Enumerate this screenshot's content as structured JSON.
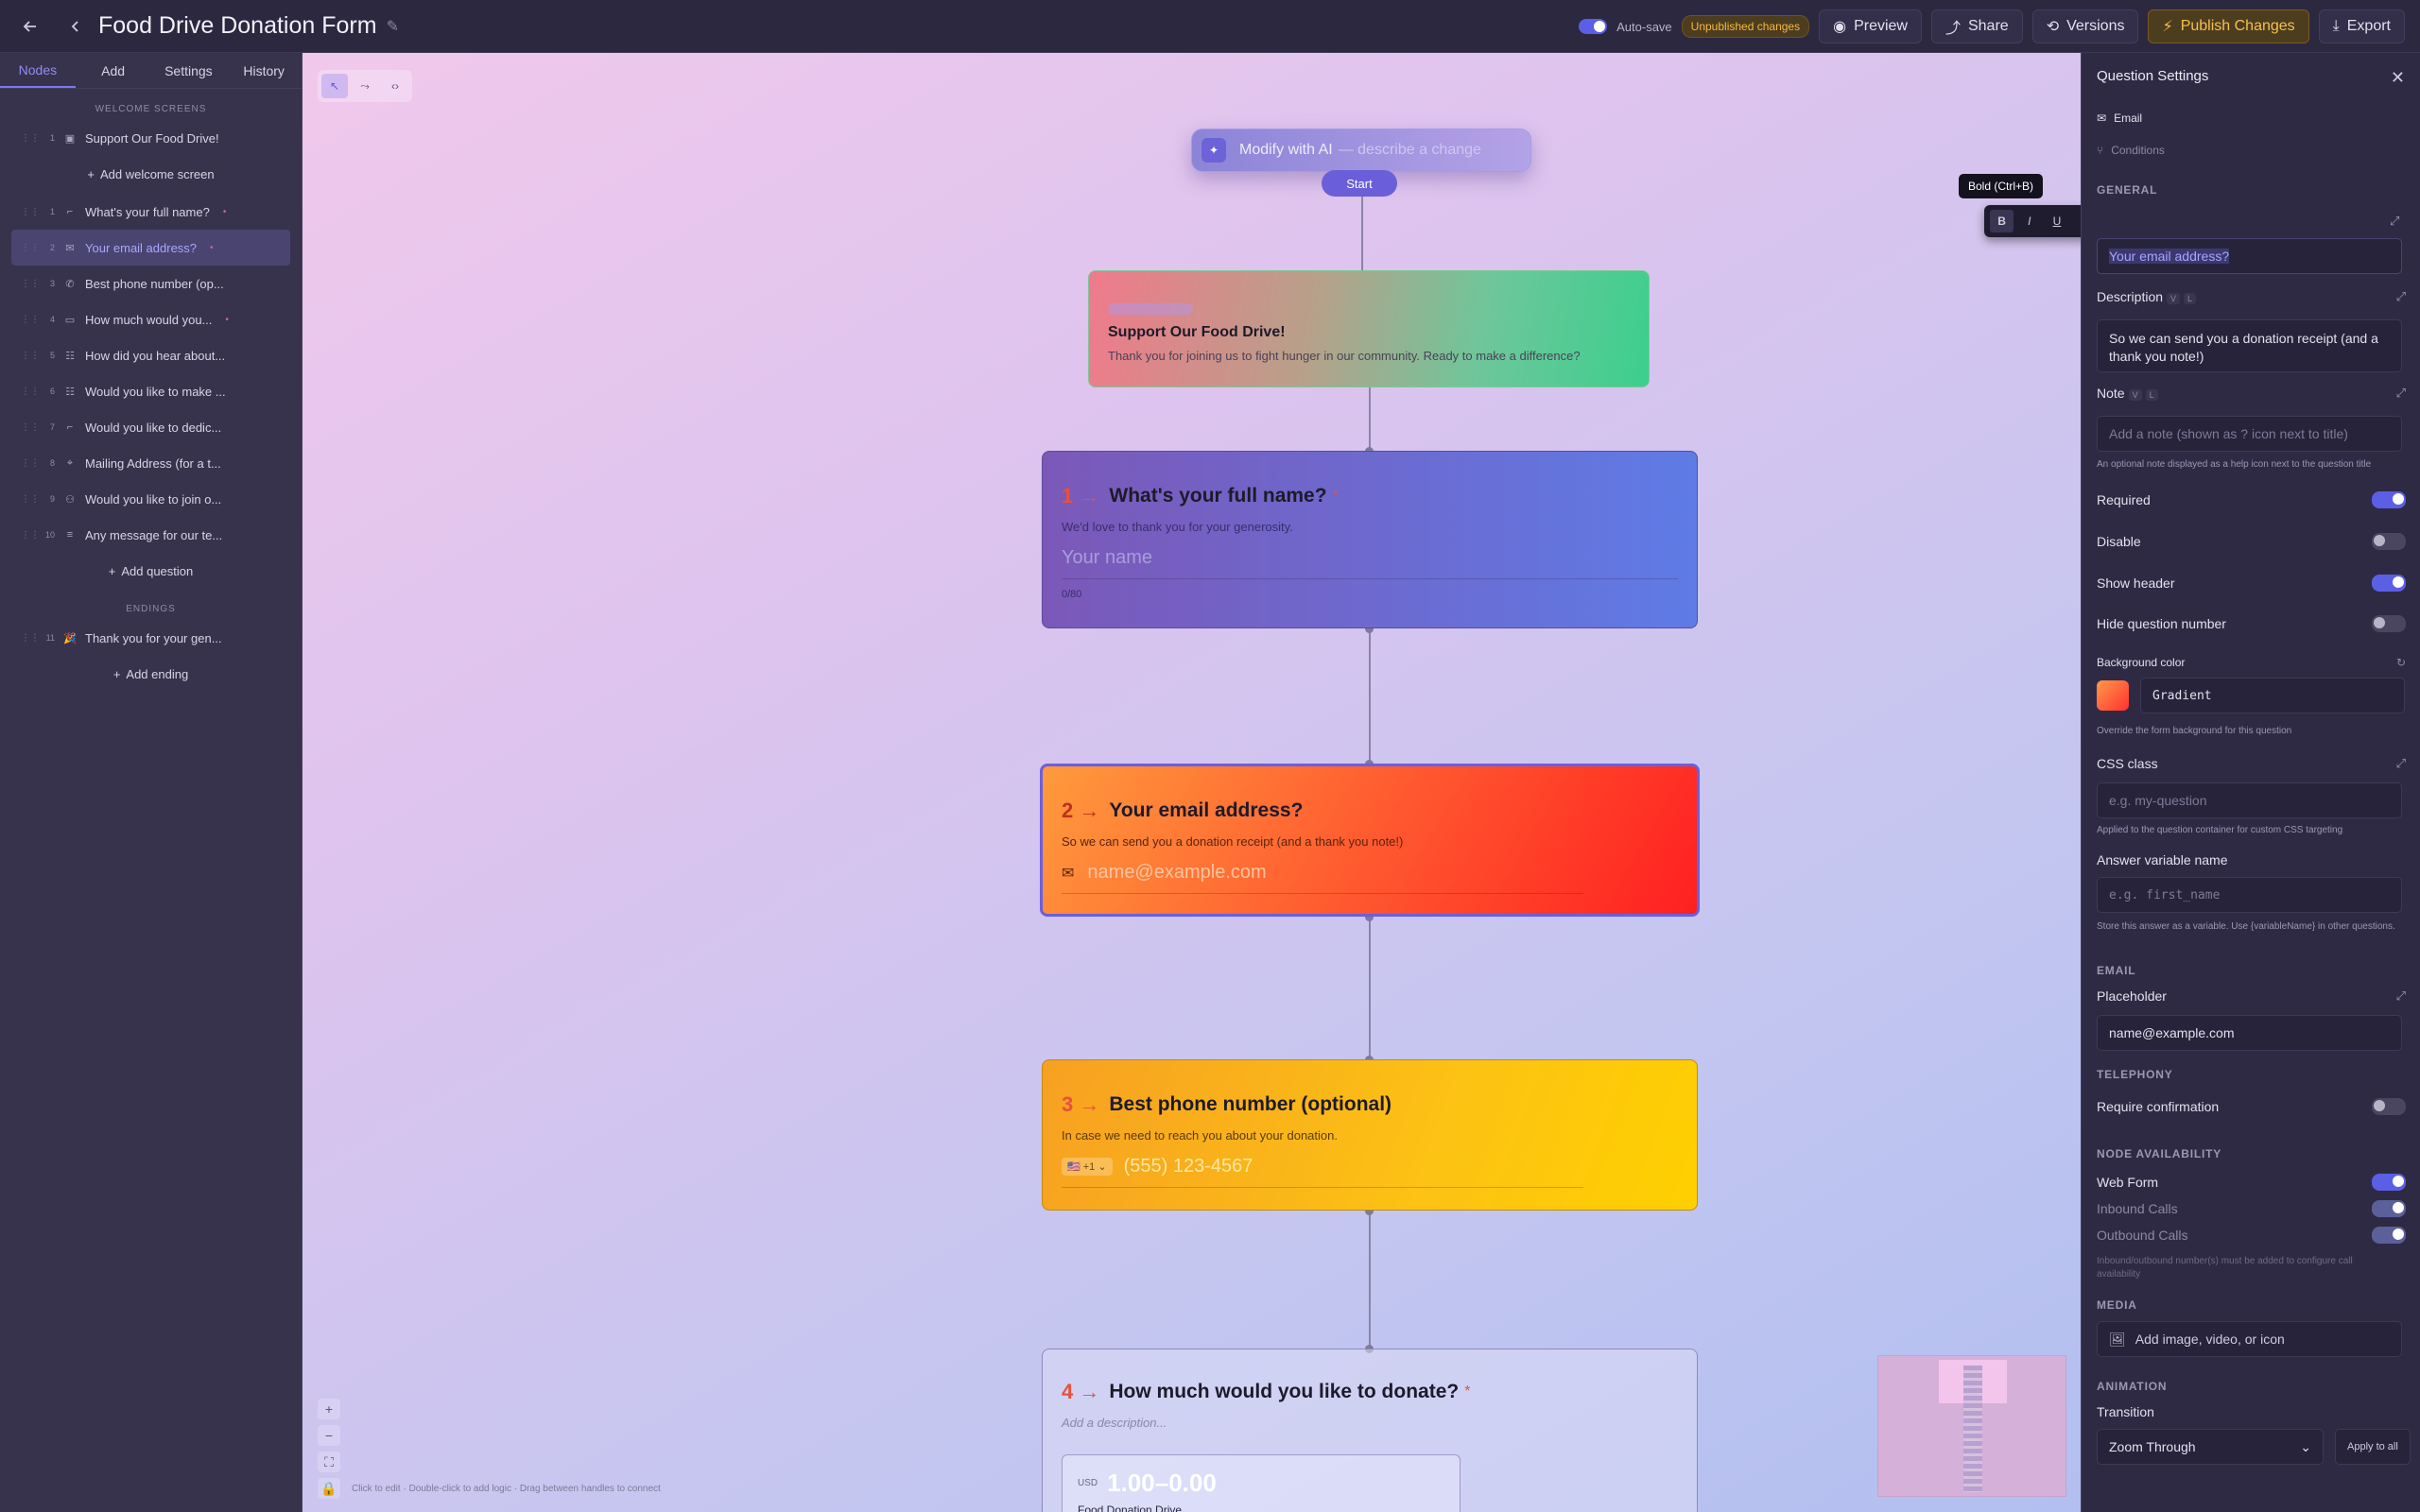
{
  "header": {
    "title": "Food Drive Donation Form",
    "autosave_label": "Auto-save",
    "unpublished_badge": "Unpublished changes",
    "buttons": {
      "preview": "Preview",
      "share": "Share",
      "versions": "Versions",
      "publish": "Publish Changes",
      "export": "Export"
    }
  },
  "sidebar": {
    "tabs": [
      "Nodes",
      "Add",
      "Settings",
      "History"
    ],
    "active_tab": "Nodes",
    "sections": {
      "welcome": "WELCOME SCREENS",
      "endings": "ENDINGS"
    },
    "welcome_items": [
      {
        "num": "1",
        "icon": "welcome-icon",
        "label": "Support Our Food Drive!"
      }
    ],
    "add_welcome": "Add welcome screen",
    "questions": [
      {
        "num": "1",
        "icon": "text-icon",
        "label": "What's your full name?",
        "required": true
      },
      {
        "num": "2",
        "icon": "email-icon",
        "label": "Your email address?",
        "required": true,
        "active": true
      },
      {
        "num": "3",
        "icon": "phone-icon",
        "label": "Best phone number (op...",
        "required": false
      },
      {
        "num": "4",
        "icon": "currency-icon",
        "label": "How much would you...",
        "required": true
      },
      {
        "num": "5",
        "icon": "choice-icon",
        "label": "How did you hear about...",
        "required": false
      },
      {
        "num": "6",
        "icon": "choice-icon",
        "label": "Would you like to make ...",
        "required": false
      },
      {
        "num": "7",
        "icon": "text-icon",
        "label": "Would you like to dedic...",
        "required": false
      },
      {
        "num": "8",
        "icon": "location-icon",
        "label": "Mailing Address (for a t...",
        "required": false
      },
      {
        "num": "9",
        "icon": "group-icon",
        "label": "Would you like to join o...",
        "required": false
      },
      {
        "num": "10",
        "icon": "longtext-icon",
        "label": "Any message for our te...",
        "required": false
      }
    ],
    "add_question": "Add question",
    "endings": [
      {
        "num": "11",
        "icon": "party-icon",
        "label": "Thank you for your gen..."
      }
    ],
    "add_ending": "Add ending"
  },
  "canvas": {
    "ai_bar": {
      "label": "Modify with AI",
      "placeholder": "— describe a change"
    },
    "start_label": "Start",
    "welcome_node": {
      "title": "Support Our Food Drive!",
      "description": "Thank you for joining us to fight hunger in our community. Ready to make a difference?"
    },
    "q1": {
      "num": "1",
      "title": "What's your full name?",
      "required": "*",
      "description": "We'd love to thank you for your generosity.",
      "placeholder": "Your name",
      "counter": "0/80"
    },
    "q2": {
      "num": "2",
      "title": "Your email address?",
      "description": "So we can send you a donation receipt (and a thank you note!)",
      "placeholder": "name@example.com"
    },
    "q3": {
      "num": "3",
      "title": "Best phone number (optional)",
      "description": "In case we need to reach you about your donation.",
      "country": "🇺🇸 +1 ⌄",
      "placeholder": "(555) 123-4567"
    },
    "q4": {
      "num": "4",
      "title": "How much would you like to donate?",
      "required": "*",
      "description": "Add a description...",
      "currency": "USD",
      "amount": "1.00–0.00",
      "sublabel": "Food Donation Drive"
    },
    "hint": "Click to edit · Double-click to add logic · Drag between handles to connect"
  },
  "panel": {
    "title": "Question Settings",
    "type_label": "Email",
    "conditions_label": "Conditions",
    "general": "GENERAL",
    "tooltip": "Bold (Ctrl+B)",
    "title_value": "Your email address?",
    "description_label": "Description",
    "description_value": "So we can send you a donation receipt (and a thank you note!)",
    "note_label": "Note",
    "note_placeholder": "Add a note (shown as ? icon next to title)",
    "note_help": "An optional note displayed as a help icon next to the question title",
    "required_label": "Required",
    "disable_label": "Disable",
    "show_header_label": "Show header",
    "hide_number_label": "Hide question number",
    "bg_label": "Background color",
    "bg_value": "Gradient",
    "bg_help": "Override the form background for this question",
    "css_label": "CSS class",
    "css_placeholder": "e.g. my-question",
    "css_help": "Applied to the question container for custom CSS targeting",
    "var_label": "Answer variable name",
    "var_placeholder": "e.g. first_name",
    "var_help": "Store this answer as a variable. Use {variableName} in other questions.",
    "email_sec": "EMAIL",
    "placeholder_label": "Placeholder",
    "placeholder_value": "name@example.com",
    "telephony_sec": "TELEPHONY",
    "require_confirm_label": "Require confirmation",
    "availability_sec": "NODE AVAILABILITY",
    "web_form_label": "Web Form",
    "inbound_label": "Inbound Calls",
    "outbound_label": "Outbound Calls",
    "availability_help": "Inbound/outbound number(s) must be added to configure call availability",
    "media_sec": "MEDIA",
    "media_label": "Add image, video, or icon",
    "animation_sec": "ANIMATION",
    "transition_label": "Transition",
    "transition_value": "Zoom Through",
    "apply_all": "Apply to all",
    "chips": [
      "V",
      "L"
    ]
  },
  "colors": {
    "accent": "#5b5fe6",
    "publish": "#f7c04a",
    "required": "#e8503c"
  }
}
